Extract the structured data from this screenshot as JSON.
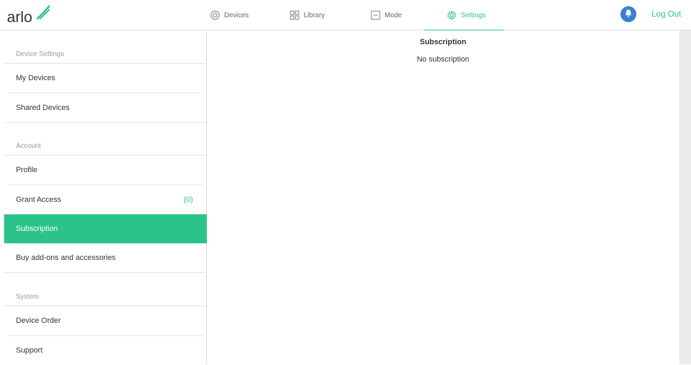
{
  "logo_text": "arlo",
  "nav": {
    "tabs": [
      {
        "label": "Devices",
        "icon": "devices-icon"
      },
      {
        "label": "Library",
        "icon": "library-icon"
      },
      {
        "label": "Mode",
        "icon": "mode-icon"
      },
      {
        "label": "Settings",
        "icon": "settings-icon",
        "active": true
      }
    ],
    "logout_label": "Log Out"
  },
  "sidebar": {
    "sections": [
      {
        "header": "Device Settings",
        "items": [
          "My Devices",
          "Shared Devices"
        ]
      },
      {
        "header": "Account",
        "items": [
          "Profile",
          "Grant Access",
          "Subscription",
          "Buy add-ons and accessories"
        ]
      },
      {
        "header": "System",
        "items": [
          "Device Order",
          "Support"
        ]
      }
    ],
    "grant_access_count": "(0)",
    "active_item": "Subscription"
  },
  "main": {
    "title": "Subscription",
    "status": "No subscription"
  },
  "colors": {
    "accent": "#2bc38a",
    "bell": "#3b7fd4",
    "gutter": "#ebebeb"
  }
}
